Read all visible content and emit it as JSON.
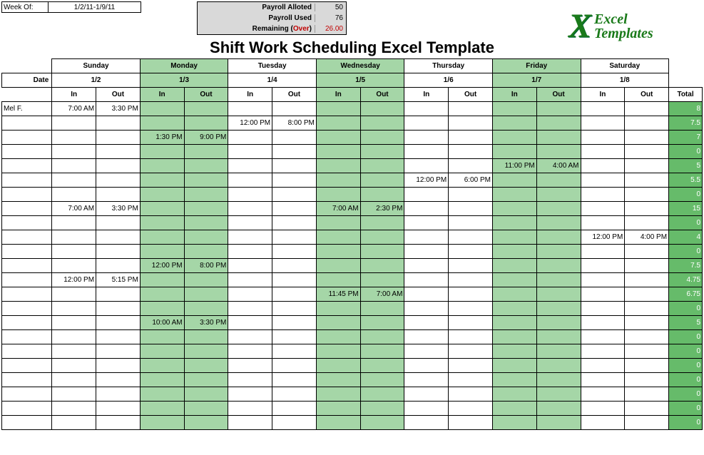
{
  "header": {
    "week_of_label": "Week Of:",
    "week_of_value": "1/2/11-1/9/11",
    "payroll_allotted_label": "Payroll Alloted",
    "payroll_allotted_value": "50",
    "payroll_used_label": "Payroll Used",
    "payroll_used_value": "76",
    "remaining_label": "Remaining (",
    "remaining_over": "Over",
    "remaining_close": ")",
    "remaining_value": "26.00"
  },
  "logo": {
    "brand1": "Excel",
    "brand2": "Templates"
  },
  "title": "Shift Work Scheduling Excel Template",
  "days": [
    "Sunday",
    "Monday",
    "Tuesday",
    "Wednesday",
    "Thursday",
    "Friday",
    "Saturday"
  ],
  "date_label": "Date",
  "dates": [
    "1/2",
    "1/3",
    "1/4",
    "1/5",
    "1/6",
    "1/7",
    "1/8"
  ],
  "in_label": "In",
  "out_label": "Out",
  "total_label": "Total",
  "rows": [
    {
      "name": "Mel F.",
      "cells": [
        "7:00 AM",
        "3:30 PM",
        "",
        "",
        "",
        "",
        "",
        "",
        "",
        "",
        "",
        "",
        "",
        ""
      ],
      "total": "8"
    },
    {
      "name": "",
      "cells": [
        "",
        "",
        "",
        "",
        "12:00 PM",
        "8:00 PM",
        "",
        "",
        "",
        "",
        "",
        "",
        "",
        ""
      ],
      "total": "7.5"
    },
    {
      "name": "",
      "cells": [
        "",
        "",
        "1:30 PM",
        "9:00 PM",
        "",
        "",
        "",
        "",
        "",
        "",
        "",
        "",
        "",
        ""
      ],
      "total": "7"
    },
    {
      "name": "",
      "cells": [
        "",
        "",
        "",
        "",
        "",
        "",
        "",
        "",
        "",
        "",
        "",
        "",
        "",
        ""
      ],
      "total": "0"
    },
    {
      "name": "",
      "cells": [
        "",
        "",
        "",
        "",
        "",
        "",
        "",
        "",
        "",
        "",
        "11:00 PM",
        "4:00 AM",
        "",
        ""
      ],
      "total": "5"
    },
    {
      "name": "",
      "cells": [
        "",
        "",
        "",
        "",
        "",
        "",
        "",
        "",
        "12:00 PM",
        "6:00 PM",
        "",
        "",
        "",
        ""
      ],
      "total": "5.5"
    },
    {
      "name": "",
      "cells": [
        "",
        "",
        "",
        "",
        "",
        "",
        "",
        "",
        "",
        "",
        "",
        "",
        "",
        ""
      ],
      "total": "0"
    },
    {
      "name": "",
      "cells": [
        "7:00 AM",
        "3:30 PM",
        "",
        "",
        "",
        "",
        "7:00 AM",
        "2:30 PM",
        "",
        "",
        "",
        "",
        "",
        ""
      ],
      "total": "15"
    },
    {
      "name": "",
      "cells": [
        "",
        "",
        "",
        "",
        "",
        "",
        "",
        "",
        "",
        "",
        "",
        "",
        "",
        ""
      ],
      "total": "0"
    },
    {
      "name": "",
      "cells": [
        "",
        "",
        "",
        "",
        "",
        "",
        "",
        "",
        "",
        "",
        "",
        "",
        "12:00 PM",
        "4:00 PM"
      ],
      "total": "4"
    },
    {
      "name": "",
      "cells": [
        "",
        "",
        "",
        "",
        "",
        "",
        "",
        "",
        "",
        "",
        "",
        "",
        "",
        ""
      ],
      "total": "0"
    },
    {
      "name": "",
      "cells": [
        "",
        "",
        "12:00 PM",
        "8:00 PM",
        "",
        "",
        "",
        "",
        "",
        "",
        "",
        "",
        "",
        ""
      ],
      "total": "7.5"
    },
    {
      "name": "",
      "cells": [
        "12:00 PM",
        "5:15 PM",
        "",
        "",
        "",
        "",
        "",
        "",
        "",
        "",
        "",
        "",
        "",
        ""
      ],
      "total": "4.75"
    },
    {
      "name": "",
      "cells": [
        "",
        "",
        "",
        "",
        "",
        "",
        "11:45 PM",
        "7:00 AM",
        "",
        "",
        "",
        "",
        "",
        ""
      ],
      "total": "6.75"
    },
    {
      "name": "",
      "cells": [
        "",
        "",
        "",
        "",
        "",
        "",
        "",
        "",
        "",
        "",
        "",
        "",
        "",
        ""
      ],
      "total": "0"
    },
    {
      "name": "",
      "cells": [
        "",
        "",
        "10:00 AM",
        "3:30 PM",
        "",
        "",
        "",
        "",
        "",
        "",
        "",
        "",
        "",
        ""
      ],
      "total": "5"
    },
    {
      "name": "",
      "cells": [
        "",
        "",
        "",
        "",
        "",
        "",
        "",
        "",
        "",
        "",
        "",
        "",
        "",
        ""
      ],
      "total": "0"
    },
    {
      "name": "",
      "cells": [
        "",
        "",
        "",
        "",
        "",
        "",
        "",
        "",
        "",
        "",
        "",
        "",
        "",
        ""
      ],
      "total": "0"
    },
    {
      "name": "",
      "cells": [
        "",
        "",
        "",
        "",
        "",
        "",
        "",
        "",
        "",
        "",
        "",
        "",
        "",
        ""
      ],
      "total": "0"
    },
    {
      "name": "",
      "cells": [
        "",
        "",
        "",
        "",
        "",
        "",
        "",
        "",
        "",
        "",
        "",
        "",
        "",
        ""
      ],
      "total": "0"
    },
    {
      "name": "",
      "cells": [
        "",
        "",
        "",
        "",
        "",
        "",
        "",
        "",
        "",
        "",
        "",
        "",
        "",
        ""
      ],
      "total": "0"
    },
    {
      "name": "",
      "cells": [
        "",
        "",
        "",
        "",
        "",
        "",
        "",
        "",
        "",
        "",
        "",
        "",
        "",
        ""
      ],
      "total": "0"
    },
    {
      "name": "",
      "cells": [
        "",
        "",
        "",
        "",
        "",
        "",
        "",
        "",
        "",
        "",
        "",
        "",
        "",
        ""
      ],
      "total": "0"
    }
  ],
  "green_day_indices": [
    1,
    3,
    5
  ]
}
